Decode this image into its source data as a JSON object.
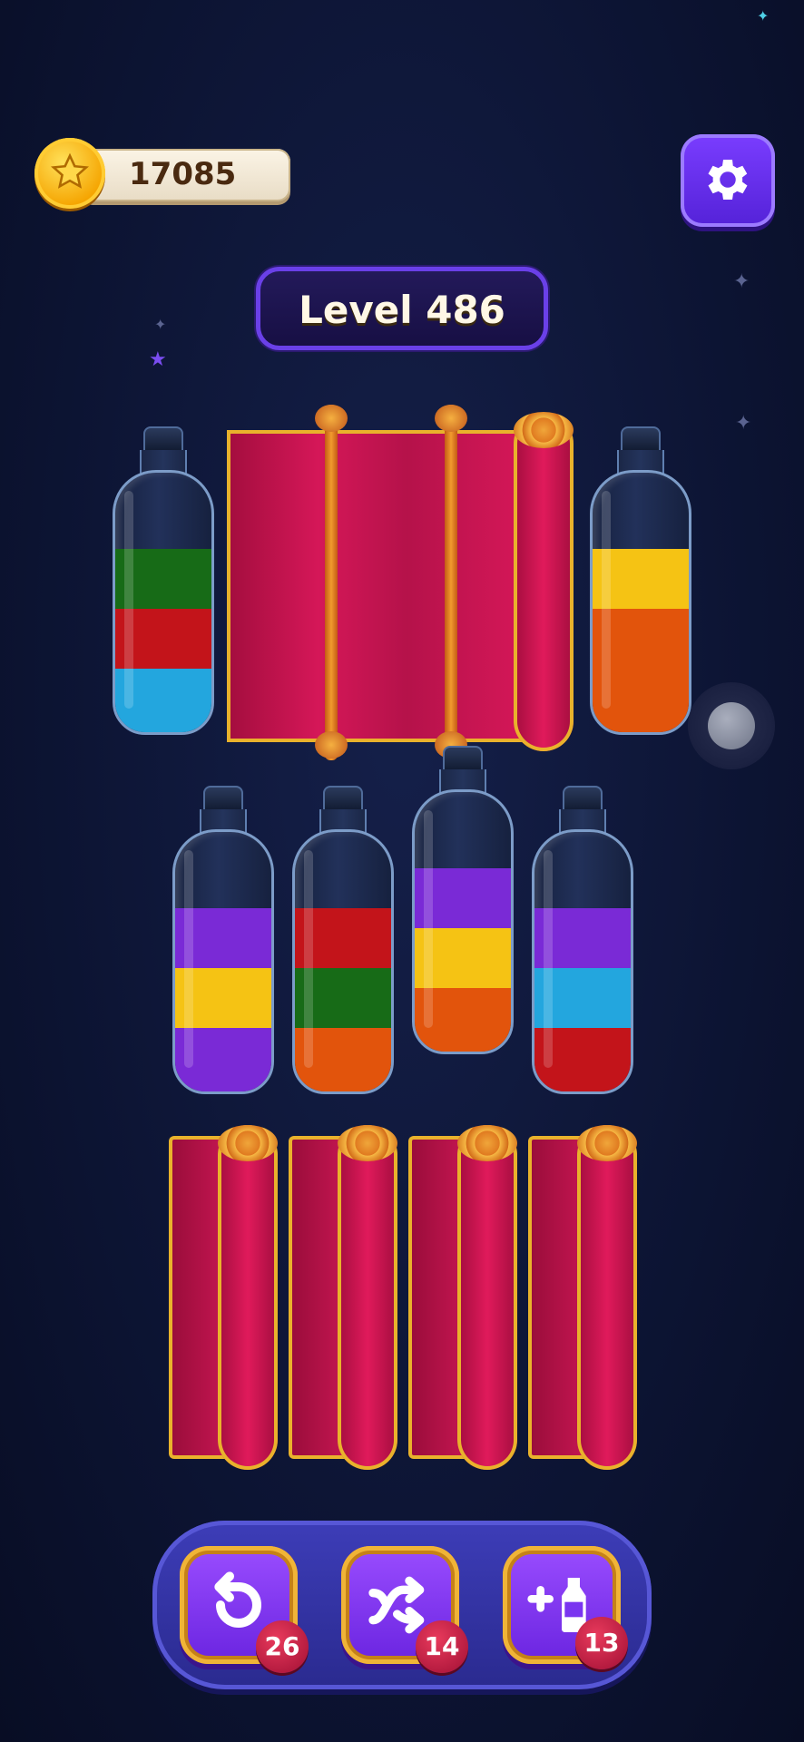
{
  "hud": {
    "coins": "17085",
    "level_label": "Level 486"
  },
  "colors": {
    "green": "#176b17",
    "red": "#c3141a",
    "blue": "#23a6de",
    "yellow": "#f5c314",
    "orange": "#e2540c",
    "purple": "#7a2ad6"
  },
  "bottles": [
    {
      "id": "top-left",
      "layers_bottom_to_top": [
        "blue",
        "red",
        "green"
      ]
    },
    {
      "id": "top-right",
      "layers_bottom_to_top": [
        "orange",
        "orange",
        "yellow"
      ]
    },
    {
      "id": "mid-1",
      "layers_bottom_to_top": [
        "purple",
        "yellow",
        "purple"
      ]
    },
    {
      "id": "mid-2",
      "layers_bottom_to_top": [
        "orange",
        "green",
        "red"
      ]
    },
    {
      "id": "mid-3",
      "layers_bottom_to_top": [
        "orange",
        "yellow",
        "purple"
      ]
    },
    {
      "id": "mid-4",
      "layers_bottom_to_top": [
        "red",
        "blue",
        "purple"
      ]
    }
  ],
  "toolbar": {
    "undo_count": "26",
    "swap_count": "14",
    "add_bottle_count": "13"
  }
}
